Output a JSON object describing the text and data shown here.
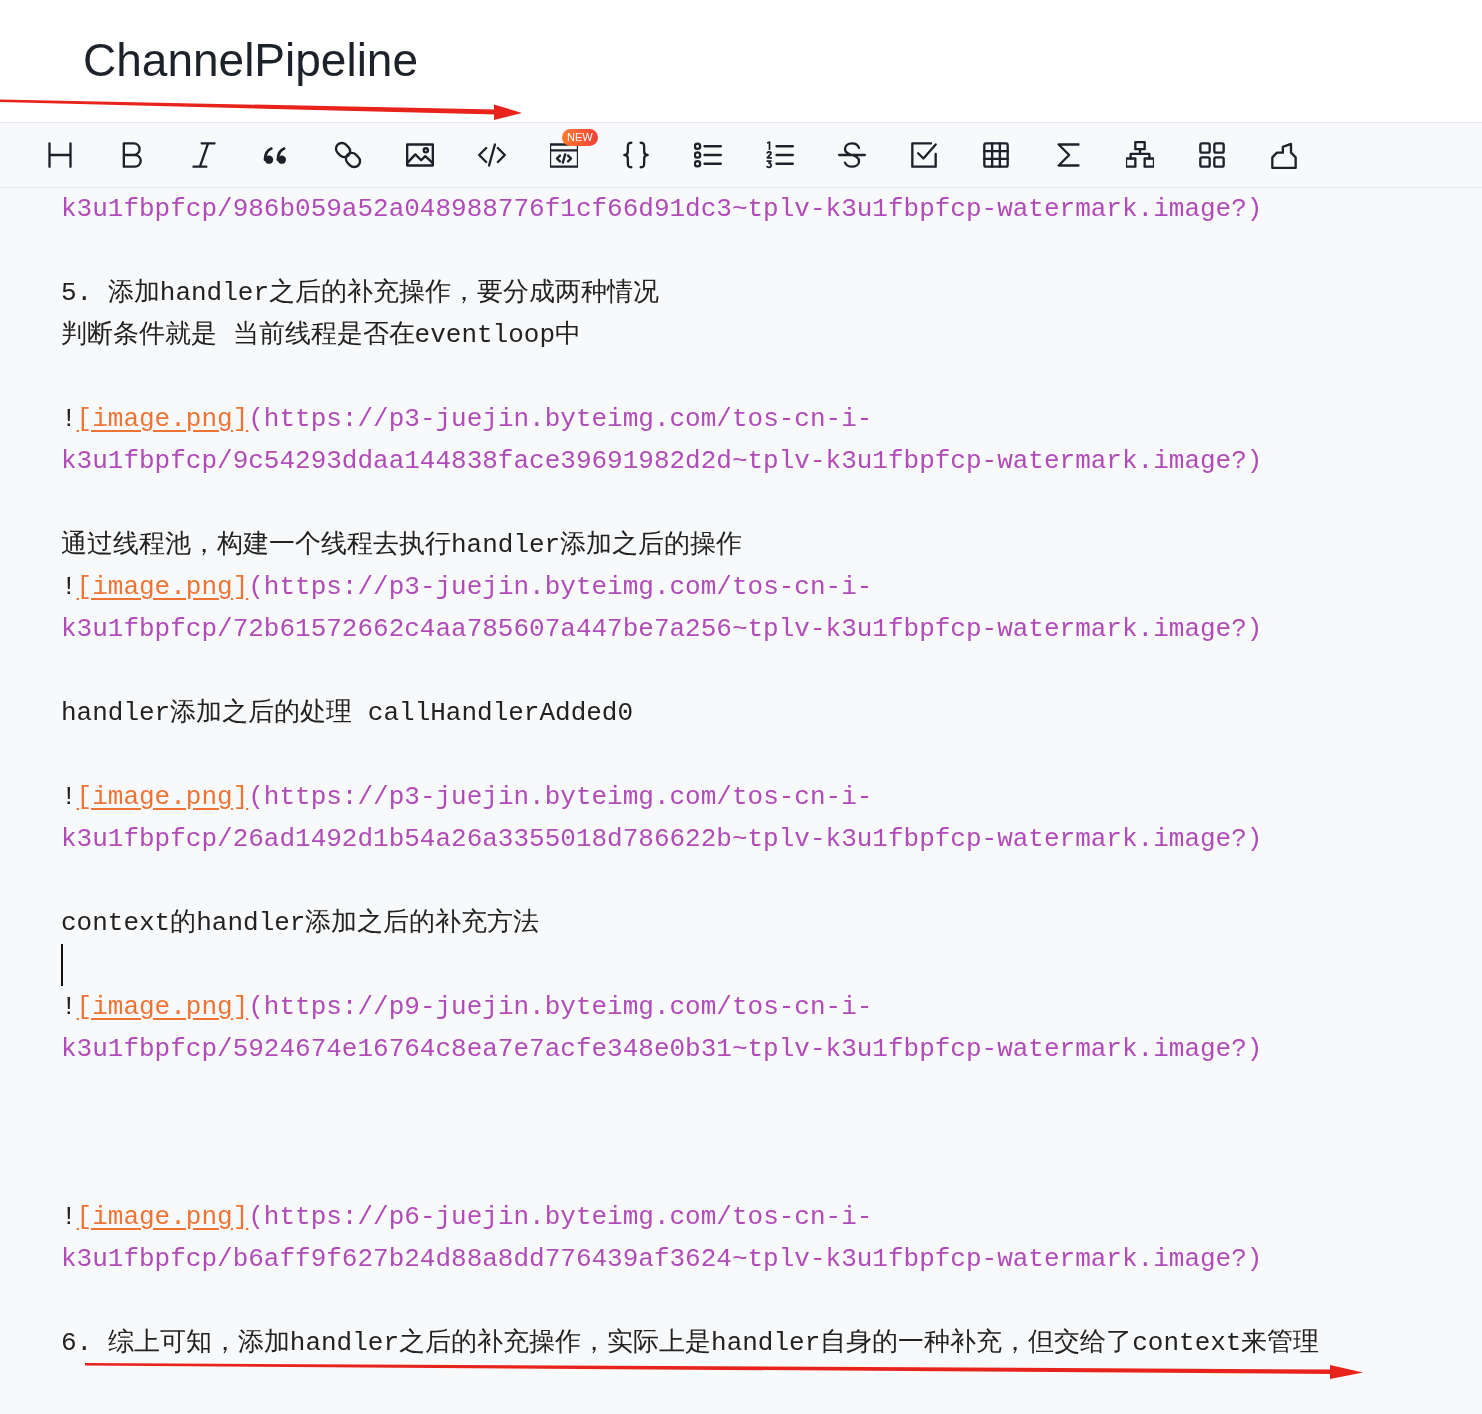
{
  "title": "ChannelPipeline",
  "annotations": [
    {
      "kind": "arrow"
    },
    {
      "kind": "arrow"
    }
  ],
  "toolbar": [
    {
      "kind": "heading"
    },
    {
      "kind": "bold"
    },
    {
      "kind": "italic"
    },
    {
      "kind": "quote"
    },
    {
      "kind": "link"
    },
    {
      "kind": "image"
    },
    {
      "kind": "code"
    },
    {
      "kind": "codeblock",
      "badge": "NEW"
    },
    {
      "kind": "braces"
    },
    {
      "kind": "bullets"
    },
    {
      "kind": "numbers"
    },
    {
      "kind": "strike"
    },
    {
      "kind": "task"
    },
    {
      "kind": "table"
    },
    {
      "kind": "formula"
    },
    {
      "kind": "diagram"
    },
    {
      "kind": "grid"
    },
    {
      "kind": "marker"
    }
  ],
  "lines": [
    {
      "kind": "url",
      "text": "k3u1fbpfcp/986b059a52a048988776f1cf66d91dc3~tplv-k3u1fbpfcp-watermark.image?)"
    },
    {
      "kind": "blank"
    },
    {
      "kind": "text",
      "text": "5. 添加handler之后的补充操作，要分成两种情况"
    },
    {
      "kind": "text",
      "text": "判断条件就是 当前线程是否在eventloop中"
    },
    {
      "kind": "blank"
    },
    {
      "kind": "image_link",
      "prefix": "!",
      "label": "[image.png]",
      "url": "(https://p3-juejin.byteimg.com/tos-cn-i-"
    },
    {
      "kind": "url",
      "text": "k3u1fbpfcp/9c54293ddaa144838face39691982d2d~tplv-k3u1fbpfcp-watermark.image?)"
    },
    {
      "kind": "blank"
    },
    {
      "kind": "text",
      "text": "通过线程池，构建一个线程去执行handler添加之后的操作"
    },
    {
      "kind": "image_link",
      "prefix": "!",
      "label": "[image.png]",
      "url": "(https://p3-juejin.byteimg.com/tos-cn-i-"
    },
    {
      "kind": "url",
      "text": "k3u1fbpfcp/72b61572662c4aa785607a447be7a256~tplv-k3u1fbpfcp-watermark.image?)"
    },
    {
      "kind": "blank"
    },
    {
      "kind": "text",
      "text": "handler添加之后的处理 callHandlerAdded0"
    },
    {
      "kind": "blank"
    },
    {
      "kind": "image_link",
      "prefix": "!",
      "label": "[image.png]",
      "url": "(https://p3-juejin.byteimg.com/tos-cn-i-"
    },
    {
      "kind": "url",
      "text": "k3u1fbpfcp/26ad1492d1b54a26a3355018d786622b~tplv-k3u1fbpfcp-watermark.image?)"
    },
    {
      "kind": "blank"
    },
    {
      "kind": "text",
      "text": "context的handler添加之后的补充方法"
    },
    {
      "kind": "caret"
    },
    {
      "kind": "image_link",
      "prefix": "!",
      "label": "[image.png]",
      "url": "(https://p9-juejin.byteimg.com/tos-cn-i-"
    },
    {
      "kind": "url",
      "text": "k3u1fbpfcp/5924674e16764c8ea7e7acfe348e0b31~tplv-k3u1fbpfcp-watermark.image?)"
    },
    {
      "kind": "blank"
    },
    {
      "kind": "blank"
    },
    {
      "kind": "blank"
    },
    {
      "kind": "image_link",
      "prefix": "!",
      "label": "[image.png]",
      "url": "(https://p6-juejin.byteimg.com/tos-cn-i-"
    },
    {
      "kind": "url",
      "text": "k3u1fbpfcp/b6aff9f627b24d88a8dd776439af3624~tplv-k3u1fbpfcp-watermark.image?)"
    },
    {
      "kind": "blank"
    },
    {
      "kind": "text",
      "text": "6. 综上可知，添加handler之后的补充操作，实际上是handler自身的一种补充，但交给了context来管理"
    }
  ]
}
